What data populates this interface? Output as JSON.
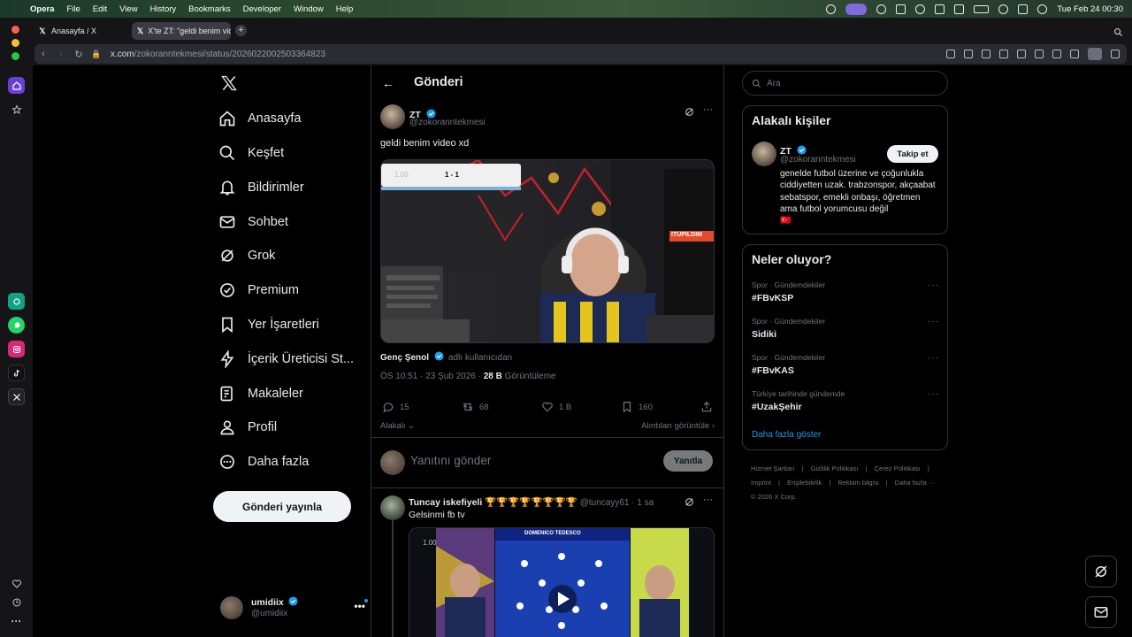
{
  "menubar": {
    "apple": "",
    "items": [
      "Opera",
      "File",
      "Edit",
      "View",
      "History",
      "Bookmarks",
      "Developer",
      "Window",
      "Help"
    ],
    "clock": "Tue Feb 24  00:30"
  },
  "tabs": [
    {
      "label": "Anasayfa / X"
    },
    {
      "label": "X'te ZT: \"geldi benim video xd\" / X"
    }
  ],
  "address": {
    "host": "x.com",
    "path": "/zokoranntekmesi/status/2026022002503364823"
  },
  "nav": {
    "items": [
      "Anasayfa",
      "Keşfet",
      "Bildirimler",
      "Sohbet",
      "Grok",
      "Premium",
      "Yer İşaretleri",
      "İçerik Üreticisi St...",
      "Makaleler",
      "Profil",
      "Daha fazla"
    ],
    "post_button": "Gönderi yayınla",
    "account": {
      "name": "umidiix",
      "handle": "@umidiix",
      "more": "•••"
    }
  },
  "header": {
    "title": "Gönderi"
  },
  "tweet": {
    "name": "ZT",
    "handle": "@zokoranntekmesi",
    "text": "geldi benim video xd",
    "video": {
      "score": "1 - 1",
      "time": "1.00",
      "banner": "ITUPILDIM"
    },
    "source_name": "Genç Şenol",
    "source_suffix": "adlı kullanıcıdan",
    "time": "ÖS 10:51 · 23 Şub 2026 ·",
    "views_count": "28 B",
    "views_label": "Görüntüleme",
    "replies": "15",
    "retweets": "68",
    "likes": "1 B",
    "bookmarks": "160",
    "sort": "Alakalı",
    "quotes_link": "Alıntıları görüntüle"
  },
  "reply_box": {
    "placeholder": "Yanıtını gönder",
    "button": "Yanıtla"
  },
  "reply": {
    "name": "Tuncay iskefiyeli 🏆🏆🏆🏆🏆🏆🏆🏆",
    "handle": "@tuncayy61 · 1 sa",
    "text": "Gelsinmi fb tv",
    "media_title": "DOMENICO TEDESCO",
    "media_time": "1.00"
  },
  "right": {
    "search_placeholder": "Ara",
    "related_title": "Alakalı kişiler",
    "related_user": {
      "name": "ZT",
      "handle": "@zokoranntekmesi",
      "follow": "Takip et",
      "bio": "genelde futbol üzerine ve çoğunlukla ciddiyetten uzak. trabzonspor, akçaabat sebatspor, emekli onbaşı, öğretmen ama futbol yorumcusu değil",
      "flag": "🇹🇷"
    },
    "trends_title": "Neler oluyor?",
    "trends": [
      {
        "meta": "Spor · Gündemdekiler",
        "tag": "#FBvKSP"
      },
      {
        "meta": "Spor · Gündemdekiler",
        "tag": "Sidiki"
      },
      {
        "meta": "Spor · Gündemdekiler",
        "tag": "#FBvKAS"
      },
      {
        "meta": "Türkiye tarihinde gündemde",
        "tag": "#UzakŞehir"
      }
    ],
    "show_more": "Daha fazla göster",
    "footer_line1": [
      "Hizmet Şartları",
      "|",
      "Gizlilik Politikası",
      "|",
      "Çerez Politikası",
      "|"
    ],
    "footer_line2": [
      "Imprint",
      "|",
      "Erişilebilirlik",
      "|",
      "Reklam bilgisi",
      "|",
      "Daha fazla ···"
    ],
    "copyright": "© 2026 X Corp."
  },
  "colors": {
    "accent": "#1d9bf0",
    "bg": "#000000",
    "border": "#2f3336",
    "muted": "#71767b"
  }
}
